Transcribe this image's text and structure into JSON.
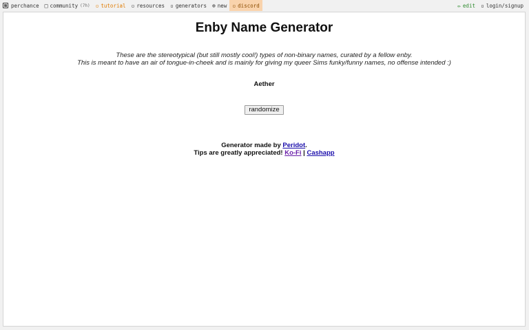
{
  "nav": {
    "brand": "perchance",
    "community": "community",
    "community_count": "(7h)",
    "tutorial": "tutorial",
    "resources": "resources",
    "generators": "generators",
    "new": "new",
    "discord": "discord",
    "edit": "edit",
    "login": "login/signup"
  },
  "main": {
    "title": "Enby Name Generator",
    "desc_line1": "These are the stereotypical (but still mostly cool!) types of non-binary names, curated by a fellow enby.",
    "desc_line2": "This is meant to have an air of tongue-in-cheek and is mainly for giving my queer Sims funky/funny names, no offense intended :)",
    "result": "Aether",
    "randomize_label": "randomize"
  },
  "credits": {
    "made_by": "Generator made by ",
    "author": "Peridot",
    "period": ".",
    "tips": "Tips are greatly appreciated! ",
    "kofi": "Ko-Fi",
    "sep": " | ",
    "cashapp": "Cashapp"
  },
  "colors": {
    "tutorial": "#e07b00",
    "discord_bg": "#f9d3ac",
    "edit": "#2e8b2e",
    "link": "#1a0dab",
    "visited": "#681da8"
  },
  "icons": [
    "dice-icon",
    "community-icon",
    "tutorial-icon",
    "resources-icon",
    "generators-icon",
    "plus-circle-icon",
    "discord-icon",
    "pencil-icon",
    "login-icon"
  ]
}
